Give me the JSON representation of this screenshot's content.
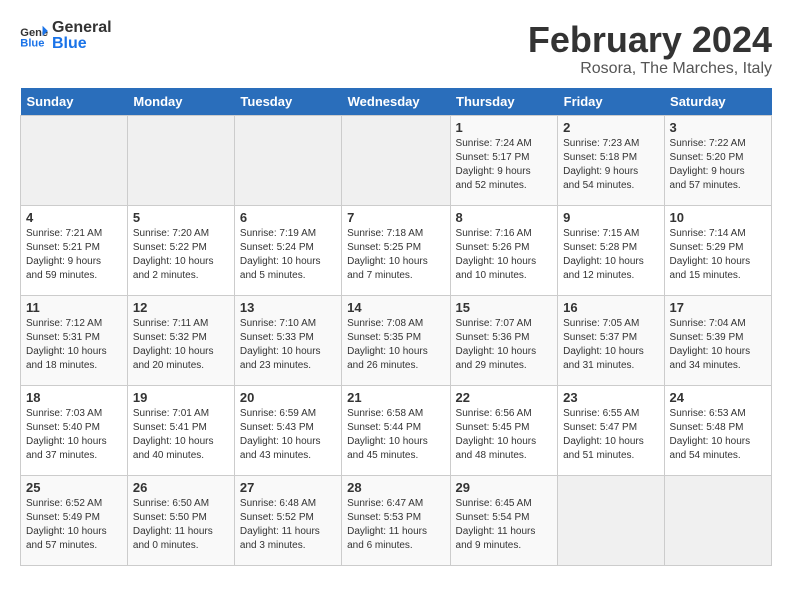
{
  "header": {
    "logo_general": "General",
    "logo_blue": "Blue",
    "title": "February 2024",
    "subtitle": "Rosora, The Marches, Italy"
  },
  "weekdays": [
    "Sunday",
    "Monday",
    "Tuesday",
    "Wednesday",
    "Thursday",
    "Friday",
    "Saturday"
  ],
  "weeks": [
    [
      {
        "day": "",
        "info": ""
      },
      {
        "day": "",
        "info": ""
      },
      {
        "day": "",
        "info": ""
      },
      {
        "day": "",
        "info": ""
      },
      {
        "day": "1",
        "info": "Sunrise: 7:24 AM\nSunset: 5:17 PM\nDaylight: 9 hours\nand 52 minutes."
      },
      {
        "day": "2",
        "info": "Sunrise: 7:23 AM\nSunset: 5:18 PM\nDaylight: 9 hours\nand 54 minutes."
      },
      {
        "day": "3",
        "info": "Sunrise: 7:22 AM\nSunset: 5:20 PM\nDaylight: 9 hours\nand 57 minutes."
      }
    ],
    [
      {
        "day": "4",
        "info": "Sunrise: 7:21 AM\nSunset: 5:21 PM\nDaylight: 9 hours\nand 59 minutes."
      },
      {
        "day": "5",
        "info": "Sunrise: 7:20 AM\nSunset: 5:22 PM\nDaylight: 10 hours\nand 2 minutes."
      },
      {
        "day": "6",
        "info": "Sunrise: 7:19 AM\nSunset: 5:24 PM\nDaylight: 10 hours\nand 5 minutes."
      },
      {
        "day": "7",
        "info": "Sunrise: 7:18 AM\nSunset: 5:25 PM\nDaylight: 10 hours\nand 7 minutes."
      },
      {
        "day": "8",
        "info": "Sunrise: 7:16 AM\nSunset: 5:26 PM\nDaylight: 10 hours\nand 10 minutes."
      },
      {
        "day": "9",
        "info": "Sunrise: 7:15 AM\nSunset: 5:28 PM\nDaylight: 10 hours\nand 12 minutes."
      },
      {
        "day": "10",
        "info": "Sunrise: 7:14 AM\nSunset: 5:29 PM\nDaylight: 10 hours\nand 15 minutes."
      }
    ],
    [
      {
        "day": "11",
        "info": "Sunrise: 7:12 AM\nSunset: 5:31 PM\nDaylight: 10 hours\nand 18 minutes."
      },
      {
        "day": "12",
        "info": "Sunrise: 7:11 AM\nSunset: 5:32 PM\nDaylight: 10 hours\nand 20 minutes."
      },
      {
        "day": "13",
        "info": "Sunrise: 7:10 AM\nSunset: 5:33 PM\nDaylight: 10 hours\nand 23 minutes."
      },
      {
        "day": "14",
        "info": "Sunrise: 7:08 AM\nSunset: 5:35 PM\nDaylight: 10 hours\nand 26 minutes."
      },
      {
        "day": "15",
        "info": "Sunrise: 7:07 AM\nSunset: 5:36 PM\nDaylight: 10 hours\nand 29 minutes."
      },
      {
        "day": "16",
        "info": "Sunrise: 7:05 AM\nSunset: 5:37 PM\nDaylight: 10 hours\nand 31 minutes."
      },
      {
        "day": "17",
        "info": "Sunrise: 7:04 AM\nSunset: 5:39 PM\nDaylight: 10 hours\nand 34 minutes."
      }
    ],
    [
      {
        "day": "18",
        "info": "Sunrise: 7:03 AM\nSunset: 5:40 PM\nDaylight: 10 hours\nand 37 minutes."
      },
      {
        "day": "19",
        "info": "Sunrise: 7:01 AM\nSunset: 5:41 PM\nDaylight: 10 hours\nand 40 minutes."
      },
      {
        "day": "20",
        "info": "Sunrise: 6:59 AM\nSunset: 5:43 PM\nDaylight: 10 hours\nand 43 minutes."
      },
      {
        "day": "21",
        "info": "Sunrise: 6:58 AM\nSunset: 5:44 PM\nDaylight: 10 hours\nand 45 minutes."
      },
      {
        "day": "22",
        "info": "Sunrise: 6:56 AM\nSunset: 5:45 PM\nDaylight: 10 hours\nand 48 minutes."
      },
      {
        "day": "23",
        "info": "Sunrise: 6:55 AM\nSunset: 5:47 PM\nDaylight: 10 hours\nand 51 minutes."
      },
      {
        "day": "24",
        "info": "Sunrise: 6:53 AM\nSunset: 5:48 PM\nDaylight: 10 hours\nand 54 minutes."
      }
    ],
    [
      {
        "day": "25",
        "info": "Sunrise: 6:52 AM\nSunset: 5:49 PM\nDaylight: 10 hours\nand 57 minutes."
      },
      {
        "day": "26",
        "info": "Sunrise: 6:50 AM\nSunset: 5:50 PM\nDaylight: 11 hours\nand 0 minutes."
      },
      {
        "day": "27",
        "info": "Sunrise: 6:48 AM\nSunset: 5:52 PM\nDaylight: 11 hours\nand 3 minutes."
      },
      {
        "day": "28",
        "info": "Sunrise: 6:47 AM\nSunset: 5:53 PM\nDaylight: 11 hours\nand 6 minutes."
      },
      {
        "day": "29",
        "info": "Sunrise: 6:45 AM\nSunset: 5:54 PM\nDaylight: 11 hours\nand 9 minutes."
      },
      {
        "day": "",
        "info": ""
      },
      {
        "day": "",
        "info": ""
      }
    ]
  ]
}
